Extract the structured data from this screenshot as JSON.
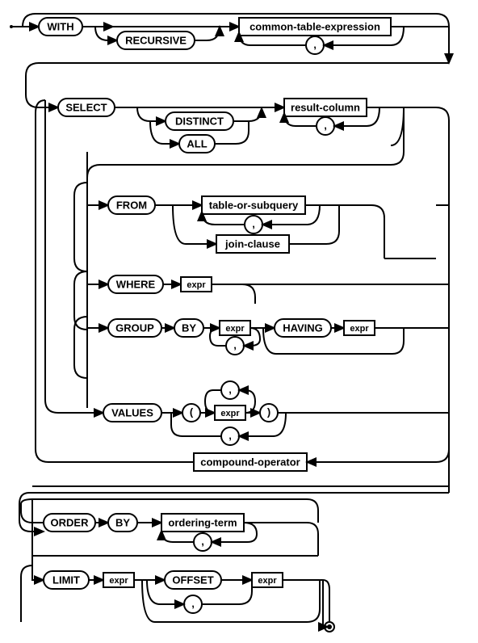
{
  "diagram": {
    "type": "railroad-syntax-diagram",
    "subject": "SQL SELECT statement",
    "keywords": {
      "with": "WITH",
      "recursive": "RECURSIVE",
      "select": "SELECT",
      "distinct": "DISTINCT",
      "all": "ALL",
      "from": "FROM",
      "where": "WHERE",
      "group": "GROUP",
      "by": "BY",
      "having": "HAVING",
      "values": "VALUES",
      "order": "ORDER",
      "by2": "BY",
      "limit": "LIMIT",
      "offset": "OFFSET"
    },
    "nonterminals": {
      "cte": "common-table-expression",
      "result_column": "result-column",
      "table_or_subquery": "table-or-subquery",
      "join_clause": "join-clause",
      "compound_operator": "compound-operator",
      "ordering_term": "ordering-term",
      "expr": "expr"
    },
    "punct": {
      "comma": ",",
      "lparen": "(",
      "rparen": ")"
    }
  }
}
